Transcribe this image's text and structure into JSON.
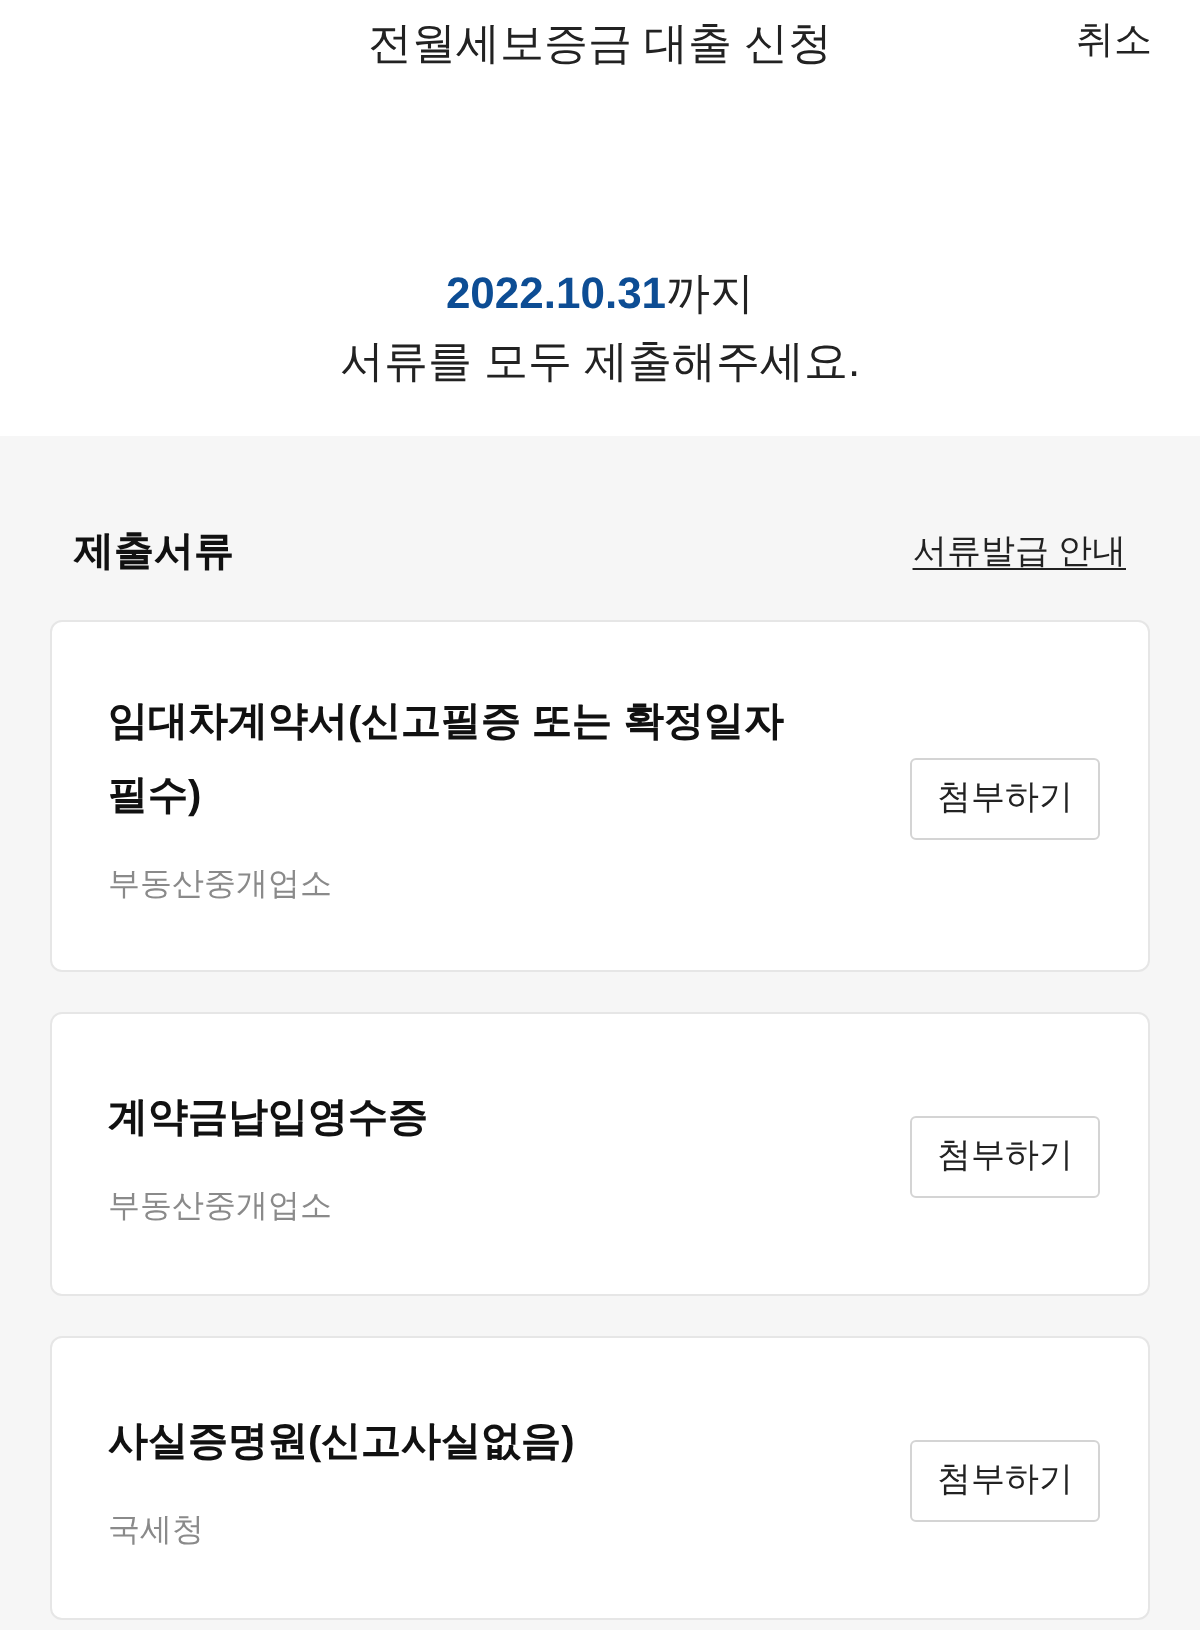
{
  "header": {
    "title": "전월세보증금 대출 신청",
    "cancel": "취소"
  },
  "notice": {
    "date": "2022.10.31",
    "date_suffix": "까지",
    "message": "서류를 모두 제출해주세요."
  },
  "documents_section": {
    "title": "제출서류",
    "link": "서류발급 안내"
  },
  "documents": [
    {
      "title": "임대차계약서(신고필증 또는 확정일자 필수)",
      "issuer": "부동산중개업소",
      "button": "첨부하기"
    },
    {
      "title": "계약금납입영수증",
      "issuer": "부동산중개업소",
      "button": "첨부하기"
    },
    {
      "title": "사실증명원(신고사실없음)",
      "issuer": "국세청",
      "button": "첨부하기"
    }
  ]
}
